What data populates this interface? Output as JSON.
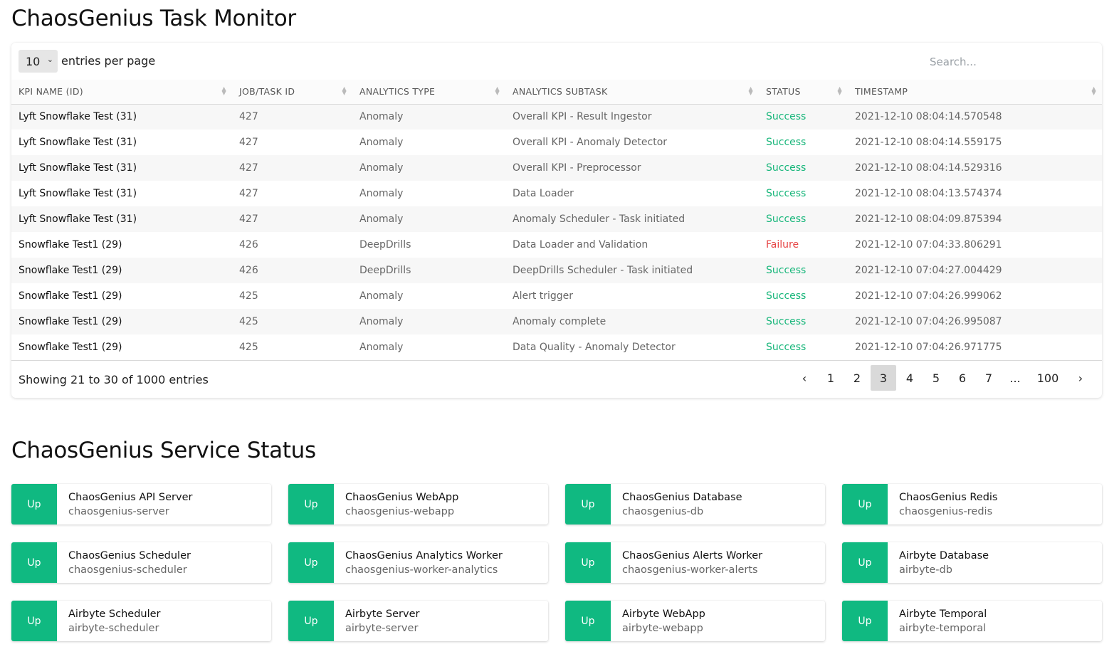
{
  "task_monitor": {
    "title": "ChaosGenius Task Monitor",
    "page_size": "10",
    "per_page_label": "entries per page",
    "search_placeholder": "Search...",
    "columns": [
      "KPI NAME (ID)",
      "JOB/TASK ID",
      "ANALYTICS TYPE",
      "ANALYTICS SUBTASK",
      "STATUS",
      "TIMESTAMP"
    ],
    "rows": [
      {
        "kpi": "Lyft Snowflake Test (31)",
        "job": "427",
        "type": "Anomaly",
        "subtask": "Overall KPI - Result Ingestor",
        "status": "Success",
        "timestamp": "2021-12-10 08:04:14.570548"
      },
      {
        "kpi": "Lyft Snowflake Test (31)",
        "job": "427",
        "type": "Anomaly",
        "subtask": "Overall KPI - Anomaly Detector",
        "status": "Success",
        "timestamp": "2021-12-10 08:04:14.559175"
      },
      {
        "kpi": "Lyft Snowflake Test (31)",
        "job": "427",
        "type": "Anomaly",
        "subtask": "Overall KPI - Preprocessor",
        "status": "Success",
        "timestamp": "2021-12-10 08:04:14.529316"
      },
      {
        "kpi": "Lyft Snowflake Test (31)",
        "job": "427",
        "type": "Anomaly",
        "subtask": "Data Loader",
        "status": "Success",
        "timestamp": "2021-12-10 08:04:13.574374"
      },
      {
        "kpi": "Lyft Snowflake Test (31)",
        "job": "427",
        "type": "Anomaly",
        "subtask": "Anomaly Scheduler - Task initiated",
        "status": "Success",
        "timestamp": "2021-12-10 08:04:09.875394"
      },
      {
        "kpi": "Snowflake Test1 (29)",
        "job": "426",
        "type": "DeepDrills",
        "subtask": "Data Loader and Validation",
        "status": "Failure",
        "timestamp": "2021-12-10 07:04:33.806291"
      },
      {
        "kpi": "Snowflake Test1 (29)",
        "job": "426",
        "type": "DeepDrills",
        "subtask": "DeepDrills Scheduler - Task initiated",
        "status": "Success",
        "timestamp": "2021-12-10 07:04:27.004429"
      },
      {
        "kpi": "Snowflake Test1 (29)",
        "job": "425",
        "type": "Anomaly",
        "subtask": "Alert trigger",
        "status": "Success",
        "timestamp": "2021-12-10 07:04:26.999062"
      },
      {
        "kpi": "Snowflake Test1 (29)",
        "job": "425",
        "type": "Anomaly",
        "subtask": "Anomaly complete",
        "status": "Success",
        "timestamp": "2021-12-10 07:04:26.995087"
      },
      {
        "kpi": "Snowflake Test1 (29)",
        "job": "425",
        "type": "Anomaly",
        "subtask": "Data Quality - Anomaly Detector",
        "status": "Success",
        "timestamp": "2021-12-10 07:04:26.971775"
      }
    ],
    "showing_text": "Showing 21 to 30 of 1000 entries",
    "pagination": {
      "prev": "‹",
      "pages": [
        "1",
        "2",
        "3",
        "4",
        "5",
        "6",
        "7",
        "...",
        "100"
      ],
      "active": "3",
      "next": "›"
    },
    "status_colors": {
      "Success": "#17b67a",
      "Failure": "#e64545"
    }
  },
  "service_status": {
    "title": "ChaosGenius Service Status",
    "up_color": "#10b981",
    "services": [
      {
        "status": "Up",
        "name": "ChaosGenius API Server",
        "host": "chaosgenius-server"
      },
      {
        "status": "Up",
        "name": "ChaosGenius WebApp",
        "host": "chaosgenius-webapp"
      },
      {
        "status": "Up",
        "name": "ChaosGenius Database",
        "host": "chaosgenius-db"
      },
      {
        "status": "Up",
        "name": "ChaosGenius Redis",
        "host": "chaosgenius-redis"
      },
      {
        "status": "Up",
        "name": "ChaosGenius Scheduler",
        "host": "chaosgenius-scheduler"
      },
      {
        "status": "Up",
        "name": "ChaosGenius Analytics Worker",
        "host": "chaosgenius-worker-analytics"
      },
      {
        "status": "Up",
        "name": "ChaosGenius Alerts Worker",
        "host": "chaosgenius-worker-alerts"
      },
      {
        "status": "Up",
        "name": "Airbyte Database",
        "host": "airbyte-db"
      },
      {
        "status": "Up",
        "name": "Airbyte Scheduler",
        "host": "airbyte-scheduler"
      },
      {
        "status": "Up",
        "name": "Airbyte Server",
        "host": "airbyte-server"
      },
      {
        "status": "Up",
        "name": "Airbyte WebApp",
        "host": "airbyte-webapp"
      },
      {
        "status": "Up",
        "name": "Airbyte Temporal",
        "host": "airbyte-temporal"
      }
    ]
  }
}
